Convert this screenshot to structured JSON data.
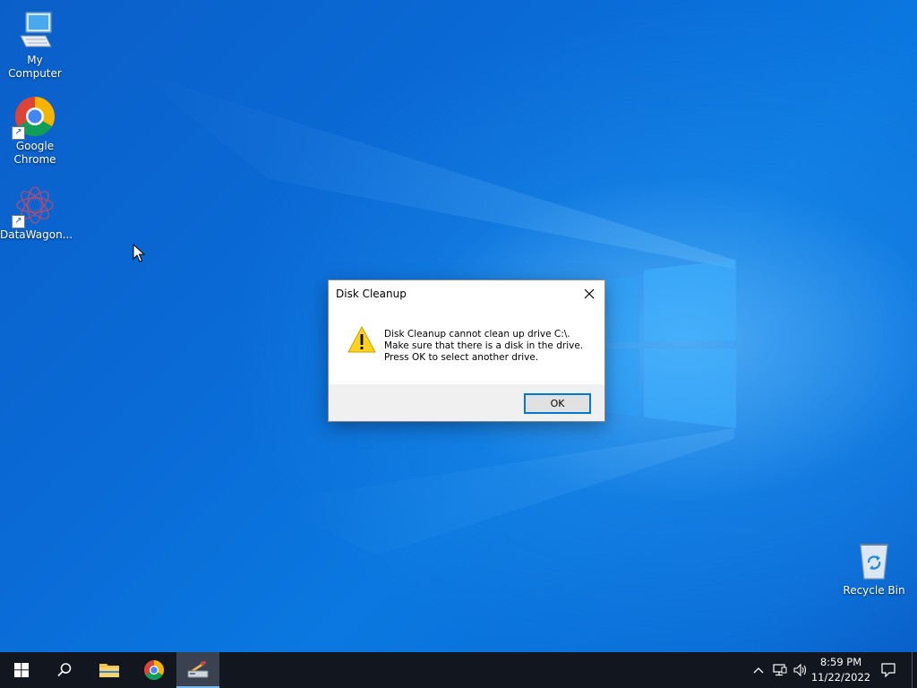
{
  "desktop": {
    "icons": [
      {
        "label": "My Computer",
        "icon": "monitor-icon"
      },
      {
        "label_line1": "Google",
        "label_line2": "Chrome",
        "icon": "chrome-icon"
      },
      {
        "label": "DataWagon...",
        "icon": "datawagon-icon"
      }
    ],
    "recycle_bin": {
      "label": "Recycle Bin",
      "icon": "recycle-bin-icon"
    }
  },
  "dialog": {
    "title": "Disk Cleanup",
    "close_icon": "close-icon",
    "warning_icon": "warning-icon",
    "message_line1": "Disk Cleanup cannot clean up drive C:\\.",
    "message_line2": "Make sure that there is a disk in the drive.",
    "message_line3": "Press OK to select another drive.",
    "ok_label": "OK"
  },
  "taskbar": {
    "start_icon": "windows-start-icon",
    "search_icon": "search-icon",
    "pinned": [
      {
        "name": "file-explorer",
        "icon": "folder-icon"
      },
      {
        "name": "google-chrome",
        "icon": "chrome-icon"
      },
      {
        "name": "disk-cleanup",
        "icon": "disk-cleanup-icon",
        "active": true
      }
    ],
    "tray": {
      "chevron_icon": "chevron-up-icon",
      "network_icon": "network-icon",
      "volume_icon": "volume-icon",
      "time": "8:59 PM",
      "date": "11/22/2022",
      "notification_icon": "notification-icon"
    }
  },
  "colors": {
    "desktop_blue": "#0a6ad6",
    "taskbar": "#11161f",
    "accent": "#0078d7",
    "dialog_footer": "#f0f0f0"
  }
}
